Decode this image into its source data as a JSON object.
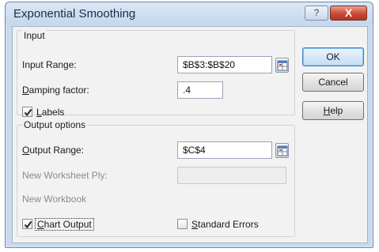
{
  "window": {
    "title": "Exponential Smoothing",
    "help_glyph": "?",
    "close_glyph": "X"
  },
  "input_section": {
    "title": "Input",
    "input_range_label": "Input Range:",
    "input_range_value": "$B$3:$B$20",
    "damping_label_prefix": "D",
    "damping_label_rest": "amping factor:",
    "damping_value": ".4",
    "labels_checkbox_label_prefix": "L",
    "labels_checkbox_label_rest": "abels",
    "labels_checked": true
  },
  "output_section": {
    "title": "Output options",
    "output_range_label_prefix": "O",
    "output_range_label_rest": "utput Range:",
    "output_range_value": "$C$4",
    "new_worksheet_label": "New Worksheet Ply:",
    "new_workbook_label": "New Workbook",
    "chart_output_label_prefix": "C",
    "chart_output_label_rest": "hart Output",
    "chart_output_checked": true,
    "standard_errors_label_prefix": "S",
    "standard_errors_label_rest": "tandard Errors",
    "standard_errors_checked": false
  },
  "buttons": {
    "ok": "OK",
    "cancel": "Cancel",
    "help_prefix": "H",
    "help_rest": "elp"
  },
  "colors": {
    "accent": "#3a7fc0",
    "close": "#c94a36"
  },
  "icons": {
    "range_selector": "range-selector-icon",
    "checkmark": "checkmark-icon"
  }
}
